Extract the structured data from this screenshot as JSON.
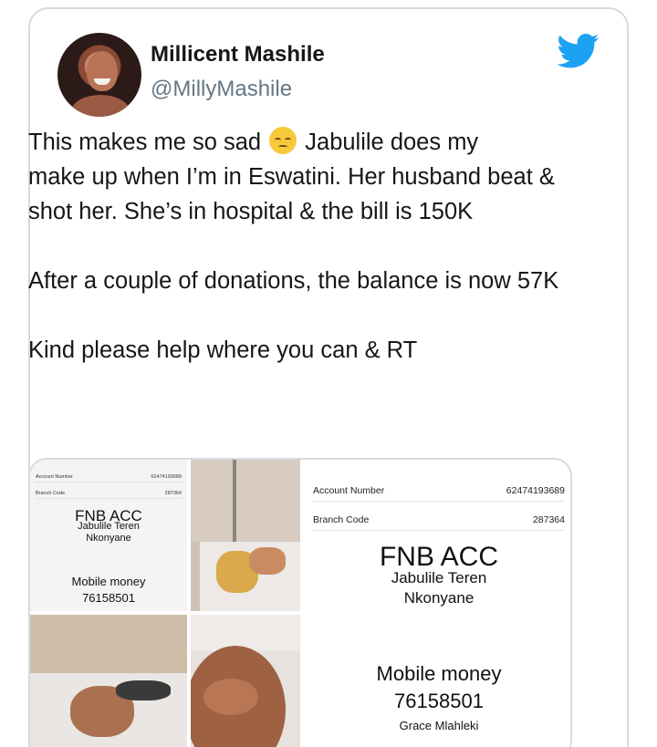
{
  "user": {
    "name": "Millicent Mashile",
    "handle": "@MillyMashile"
  },
  "tweet": {
    "line1a": "This makes me so sad ",
    "line1b": " Jabulile does my",
    "rest": "make up when I’m in Eswatini. Her husband beat & shot her. She’s in hospital & the bill is 150K\n\nAfter a couple of donations, the balance is now 57K\n\nKind please help where you can & RT",
    "emoji": "disappointed-face"
  },
  "receipt_small": {
    "account_label": "Account Number",
    "account_value": "62474193689",
    "branch_label": "Branch Code",
    "branch_value": "287364",
    "bank": "FNB ACC",
    "name1": "Jabulile Teren",
    "name2": "Nkonyane",
    "mobile_label": "Mobile money",
    "mobile_number": "76158501"
  },
  "receipt_large": {
    "account_label": "Account Number",
    "account_value": "62474193689",
    "branch_label": "Branch Code",
    "branch_value": "287364",
    "bank": "FNB ACC",
    "name1": "Jabulile Teren",
    "name2": "Nkonyane",
    "mobile_label": "Mobile money",
    "mobile_number": "76158501",
    "mobile_name": "Grace Mlahleki"
  },
  "colors": {
    "twitter_blue": "#1da1f2",
    "border": "#d4dbe1",
    "handle_gray": "#657786"
  },
  "icons": {
    "logo": "twitter-bird-icon"
  }
}
